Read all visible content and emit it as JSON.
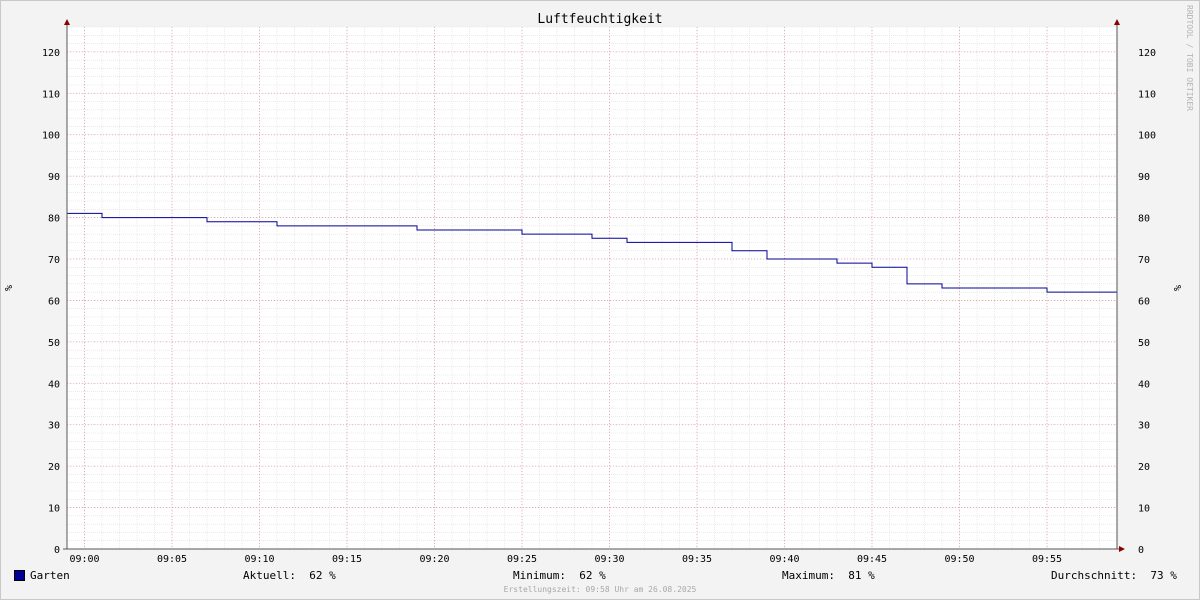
{
  "chart_data": {
    "type": "line",
    "title": "Luftfeuchtigkeit",
    "ylabel": "%",
    "ylim": [
      0,
      126
    ],
    "yticks": [
      0,
      10,
      20,
      30,
      40,
      50,
      60,
      70,
      80,
      90,
      100,
      110,
      120
    ],
    "x_start": "08:59",
    "x_end": "09:59",
    "xticks": [
      "09:00",
      "09:05",
      "09:10",
      "09:15",
      "09:20",
      "09:25",
      "09:30",
      "09:35",
      "09:40",
      "09:45",
      "09:50",
      "09:55"
    ],
    "grid": true,
    "series": [
      {
        "name": "Garten",
        "color": "#000099",
        "step": true,
        "points": [
          [
            "08:59",
            81
          ],
          [
            "09:01",
            80
          ],
          [
            "09:07",
            79
          ],
          [
            "09:11",
            78
          ],
          [
            "09:19",
            77
          ],
          [
            "09:25",
            76
          ],
          [
            "09:29",
            75
          ],
          [
            "09:31",
            74
          ],
          [
            "09:37",
            72
          ],
          [
            "09:39",
            70
          ],
          [
            "09:43",
            69
          ],
          [
            "09:45",
            68
          ],
          [
            "09:47",
            64
          ],
          [
            "09:49",
            63
          ],
          [
            "09:55",
            62
          ],
          [
            "09:59",
            62
          ]
        ]
      }
    ]
  },
  "watermark": "RRDTOOL / TOBI OETIKER",
  "legend": {
    "series_name": "Garten",
    "current_label": "Aktuell:",
    "current_value": "62 %",
    "min_label": "Minimum:",
    "min_value": "62 %",
    "max_label": "Maximum:",
    "max_value": "81 %",
    "avg_label": "Durchschnitt:",
    "avg_value": "73 %"
  },
  "footer": "Erstellungszeit: 09:58 Uhr am 26.08.2025"
}
